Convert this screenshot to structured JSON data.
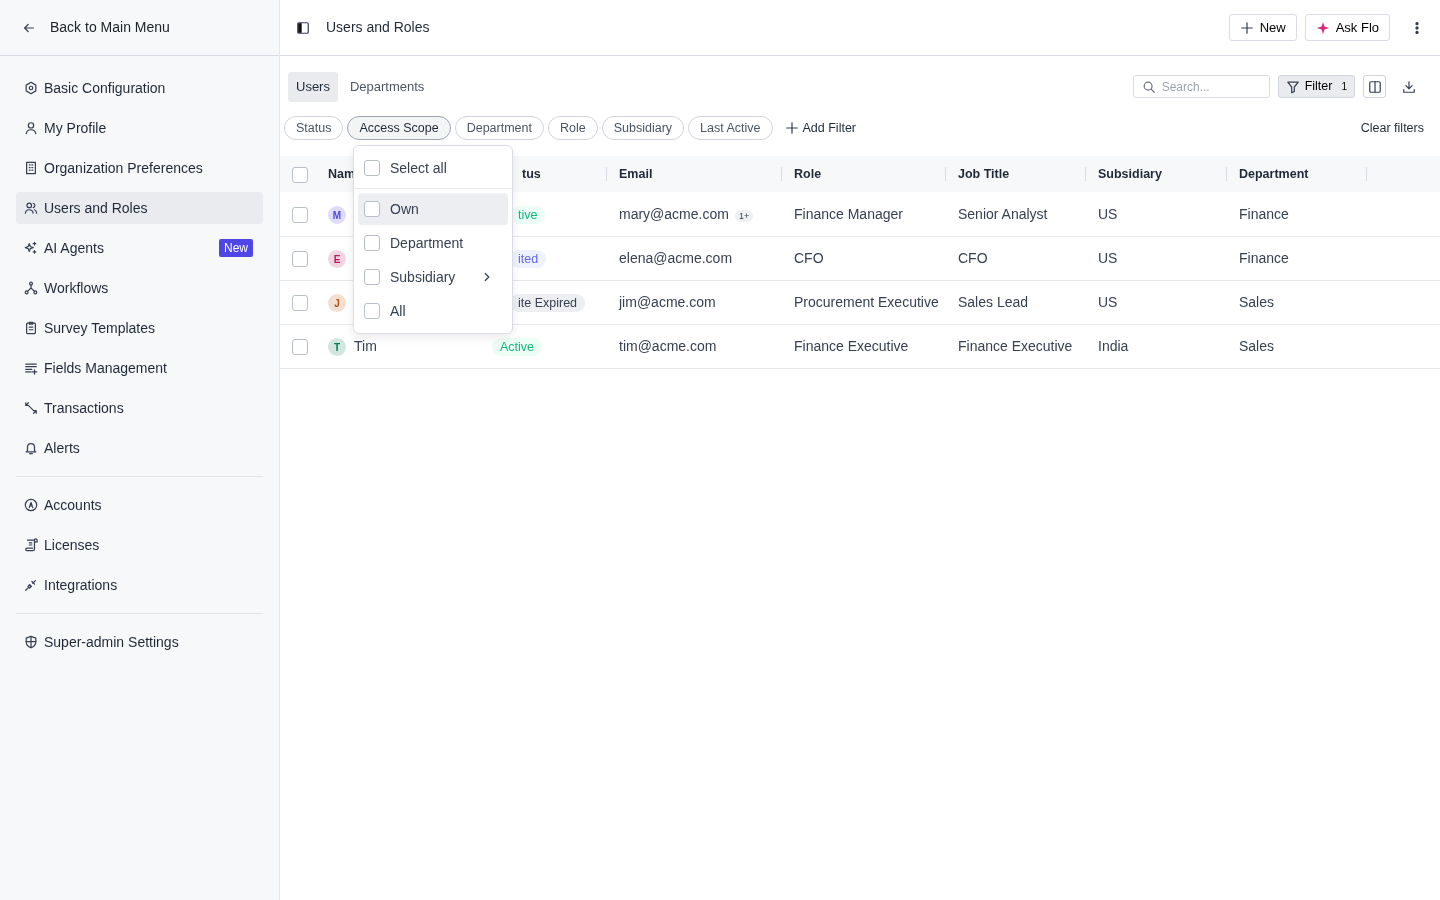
{
  "sidebar": {
    "back": "Back to Main Menu",
    "groups": [
      [
        {
          "label": "Basic Configuration",
          "selected": false
        },
        {
          "label": "My Profile",
          "selected": false
        },
        {
          "label": "Organization Preferences",
          "selected": false
        },
        {
          "label": "Users and Roles",
          "selected": true
        },
        {
          "label": "AI Agents",
          "selected": false,
          "badge": "New"
        },
        {
          "label": "Workflows",
          "selected": false
        },
        {
          "label": "Survey Templates",
          "selected": false
        },
        {
          "label": "Fields Management",
          "selected": false
        },
        {
          "label": "Transactions",
          "selected": false
        },
        {
          "label": "Alerts",
          "selected": false
        }
      ],
      [
        {
          "label": "Accounts",
          "selected": false
        },
        {
          "label": "Licenses",
          "selected": false
        },
        {
          "label": "Integrations",
          "selected": false
        }
      ],
      [
        {
          "label": "Super-admin Settings",
          "selected": false
        }
      ]
    ]
  },
  "header": {
    "title": "Users and Roles",
    "buttons": [
      "New",
      "Ask Flo"
    ]
  },
  "tabs": [
    {
      "label": "Users",
      "selected": true
    },
    {
      "label": "Departments",
      "selected": false
    }
  ],
  "toolbar": {
    "search": {
      "placeholder": "Search..."
    },
    "filter": {
      "label": "Filter",
      "count": "1"
    }
  },
  "filters": [
    {
      "label": "Status",
      "selected": false
    },
    {
      "label": "Access Scope",
      "selected": true
    },
    {
      "label": "Department",
      "selected": false
    },
    {
      "label": "Role",
      "selected": false
    },
    {
      "label": "Subsidiary",
      "selected": false
    },
    {
      "label": "Last Active",
      "selected": false
    }
  ],
  "add_filter": "Add Filter",
  "clear_filters": "Clear filters",
  "dropdown": {
    "select_all": {
      "label": "Select all",
      "checked": false
    },
    "options": [
      {
        "label": "Own",
        "checked": false,
        "hovered": true,
        "submenu": false
      },
      {
        "label": "Department",
        "checked": false,
        "hovered": false,
        "submenu": false
      },
      {
        "label": "Subsidiary",
        "checked": false,
        "hovered": false,
        "submenu": true
      },
      {
        "label": "All",
        "checked": false,
        "hovered": false,
        "submenu": false
      }
    ]
  },
  "table": {
    "all_checked": false,
    "columns": [
      "Nam",
      "tus",
      "Email",
      "Role",
      "Job Title",
      "Subsidiary",
      "Department"
    ],
    "rows": [
      {
        "checked": false,
        "initial": "M",
        "color": "#4f46e5",
        "status": {
          "text": "tive",
          "kind": "active"
        },
        "email": "mary@acme.com",
        "email_extra": "1+",
        "role": "Finance Manager",
        "job_title": "Senior Analyst",
        "subsidiary": "US",
        "department": "Finance"
      },
      {
        "checked": false,
        "initial": "E",
        "color": "#be185d",
        "status": {
          "text": "ited",
          "kind": "invited"
        },
        "email": "elena@acme.com",
        "role": "CFO",
        "job_title": "CFO",
        "subsidiary": "US",
        "department": "Finance"
      },
      {
        "checked": false,
        "initial": "J",
        "color": "#b45309",
        "status": {
          "text": "ite Expired",
          "kind": "expired"
        },
        "email": "jim@acme.com",
        "role": "Procurement Executive",
        "job_title": "Sales Lead",
        "subsidiary": "US",
        "department": "Sales"
      },
      {
        "checked": false,
        "initial": "T",
        "name": "Tim",
        "color": "#047857",
        "status": {
          "text": "Active",
          "kind": "active"
        },
        "email": "tim@acme.com",
        "role": "Finance Executive",
        "job_title": "Finance Executive",
        "subsidiary": "India",
        "department": "Sales"
      }
    ]
  }
}
